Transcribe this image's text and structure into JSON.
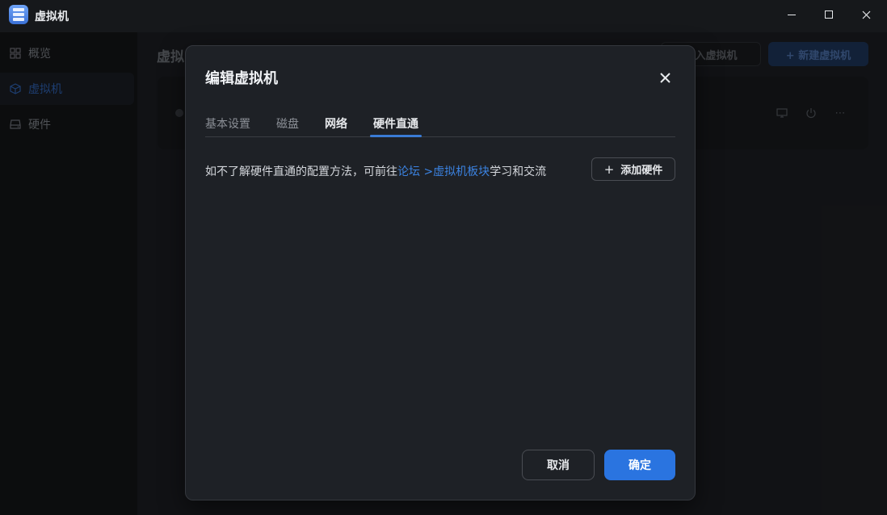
{
  "app": {
    "title": "虚拟机"
  },
  "window_controls": {
    "minimize": "minimize-icon",
    "maximize": "maximize-icon",
    "close": "close-icon"
  },
  "sidebar": {
    "items": [
      {
        "label": "概览",
        "icon": "grid-icon"
      },
      {
        "label": "虚拟机",
        "icon": "cube-icon",
        "active": true
      },
      {
        "label": "硬件",
        "icon": "drive-icon"
      }
    ]
  },
  "main": {
    "title": "虚拟",
    "import_button": "导入虚拟机",
    "new_button": "+ 新建虚拟机"
  },
  "dialog": {
    "title": "编辑虚拟机",
    "tabs": [
      {
        "label": "基本设置"
      },
      {
        "label": "磁盘"
      },
      {
        "label": "网络"
      },
      {
        "label": "硬件直通",
        "active": true
      }
    ],
    "info_prefix": "如不了解硬件直通的配置方法，可前往",
    "info_link": "论坛 >虚拟机板块",
    "info_suffix": "学习和交流",
    "add_button": "添加硬件",
    "cancel_button": "取消",
    "ok_button": "确定"
  },
  "colors": {
    "accent": "#2a74e0",
    "link": "#3b82e0"
  }
}
